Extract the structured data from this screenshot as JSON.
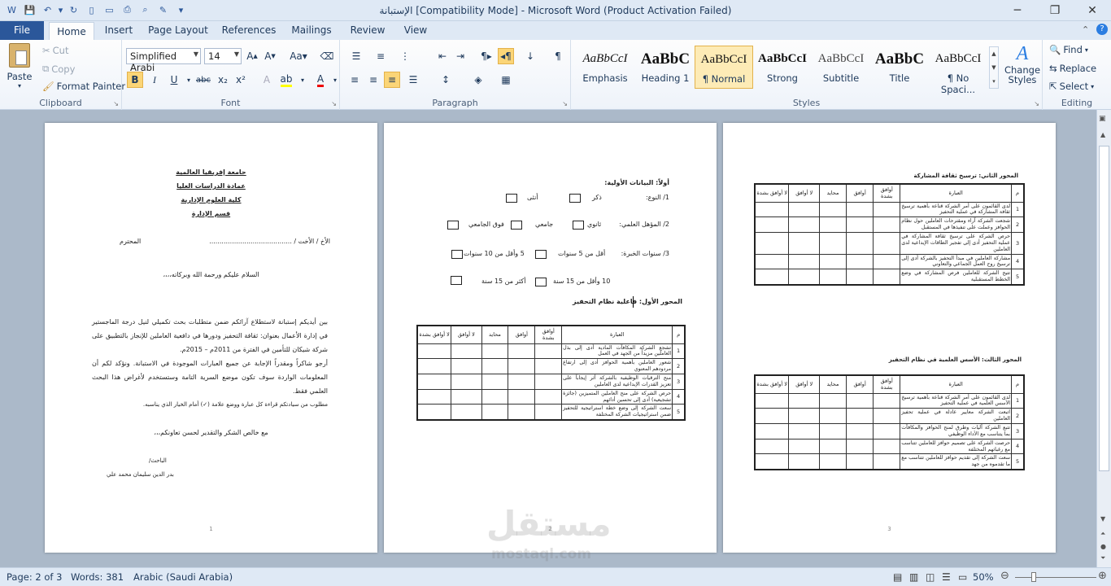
{
  "window": {
    "title": "الإستبانة [Compatibility Mode]  -  Microsoft Word (Product Activation Failed)"
  },
  "tabs": [
    {
      "label": "File"
    },
    {
      "label": "Home"
    },
    {
      "label": "Insert"
    },
    {
      "label": "Page Layout"
    },
    {
      "label": "References"
    },
    {
      "label": "Mailings"
    },
    {
      "label": "Review"
    },
    {
      "label": "View"
    }
  ],
  "clipboard": {
    "paste": "Paste",
    "cut": "Cut",
    "copy": "Copy",
    "format_painter": "Format Painter",
    "group": "Clipboard"
  },
  "font": {
    "name": "Simplified Arabi",
    "size": "14",
    "group": "Font"
  },
  "paragraph": {
    "group": "Paragraph"
  },
  "styles": {
    "group": "Styles",
    "items": [
      {
        "preview": "AaBbCcI",
        "name": "Emphasis"
      },
      {
        "preview": "AaBbC",
        "name": "Heading 1"
      },
      {
        "preview": "AaBbCcI",
        "name": "¶ Normal"
      },
      {
        "preview": "AaBbCcI",
        "name": "Strong"
      },
      {
        "preview": "AaBbCcI",
        "name": "Subtitle"
      },
      {
        "preview": "AaBbC",
        "name": "Title"
      },
      {
        "preview": "AaBbCcI",
        "name": "¶ No Spaci..."
      }
    ],
    "change": "Change Styles"
  },
  "editing": {
    "find": "Find",
    "replace": "Replace",
    "select": "Select",
    "group": "Editing"
  },
  "page1": {
    "h1": "جامعة إفريقيا العالمية",
    "h2": "عمادة الدراسات العليا",
    "h3": "كلية العلوم الإدارية",
    "h4": "قسم الإدارة",
    "address": "الأخ / الأخت / ........................................",
    "respect": "المحترم",
    "greeting": "السلام عليكم ورحمة الله وبركاته،،،،",
    "body1": "بين أيديكم إستبانة لاستطلاع آرائكم ضمن متطلبات بحث تكميلي لنيل درجة الماجستير في إدارة الأعمال بعنوان: ثقافة التحفيز ودورها في دافعية العاملين للإنجاز بالتطبيق على شركة شيكان للتأمين في الفترة من 2011م – 2015م.",
    "body2": "أرجو شاكراً ومقدراً الإجابة عن جميع العبارات الموجودة في الاستبانة. ونؤكد لكم أن المعلومات الواردة سوف تكون موضع السرية التامة وستستخدم لأغراض هذا البحث العلمي فقط.",
    "body3": "مطلوب من سيادتكم قراءة كل عبارة ووضع علامة (✓) أمام الخيار الذي يناسبه.",
    "thanks": "مع خالص الشكر والتقدير لحسن تعاونكم،،،",
    "researcher": "الباحث/",
    "researcher_name": "بدر الدين سليمان محمد علي",
    "pnum": "1"
  },
  "page2": {
    "section": "أولاً: البيانات الأولية:",
    "q1": "1/ النوع:",
    "male": "ذكر",
    "female": "أنثى",
    "q2": "2/ المؤهل العلمي:",
    "o1": "ثانوي",
    "o2": "جامعي",
    "o3": "فوق الجامعي",
    "q3": "3/ سنوات الخبرة:",
    "e1": "أقل من 5 سنوات",
    "e2": "5 وأقل من 10 سنوات",
    "e3": "10 وأقل من 15 سنة",
    "e4": "أكثر من 15 سنة",
    "axis": "المحور الأول: فاعلية نظام التحفيز",
    "pnum": "2"
  },
  "table_headers": [
    "م",
    "العبارة",
    "أوافق بشدة",
    "أوافق",
    "محايد",
    "لا أوافق",
    "لا أوافق بشدة"
  ],
  "table1_rows": [
    {
      "n": "1",
      "text": "تشجع الشركة المكافآت المادية أدى إلى بذل العاملين مزيداً من الجهد في العمل"
    },
    {
      "n": "2",
      "text": "شعور العاملين بأهمية الحوافز أدى إلى ارتفاع مردودهم المعنوي"
    },
    {
      "n": "3",
      "text": "منح الترقيات الوظيفية بالشركة أثر إيجاباً على تعزيز القدرات الإبداعية لدى العاملين"
    },
    {
      "n": "4",
      "text": "حرص الشركة على منح العاملين المتميزين (جائزة تشجيعية) أدى إلى تحسين أدائهم"
    },
    {
      "n": "5",
      "text": "سعت الشركة إلى وضع خطة استراتيجية للتحفيز ضمن استراتيجيات الشركة المختلفة"
    }
  ],
  "page3": {
    "axis2": "المحور الثاني: ترسيخ ثقافة المشاركة",
    "axis3": "المحور الثالث: الأسس العلمية في نظام التحفيز",
    "pnum": "3"
  },
  "table2_rows": [
    {
      "n": "1",
      "text": "لدى القائمون على أمر الشركة قناعة بأهمية ترسيخ ثقافة المشاركة في عملية التحفيز"
    },
    {
      "n": "2",
      "text": "شجعت الشركة آراء ومقترحات العاملين حول نظام الحوافز وعملت على تنفيذها في المستقبل"
    },
    {
      "n": "3",
      "text": "حرص الشركة على ترسيخ ثقافة المشاركة في عملية التحفيز أدى إلى تفجير الطاقات الإبداعية لدى العاملين"
    },
    {
      "n": "4",
      "text": "مشاركة العاملين في مبدأ التحفيز بالشركة أدى إلى ترسيخ روح العمل الجماعي والتعاوني"
    },
    {
      "n": "5",
      "text": "تتيح الشركة للعاملين فرص المشاركة في وضع الخطط المستقبلية"
    }
  ],
  "table3_rows": [
    {
      "n": "1",
      "text": "لدى القائمون على أمر الشركة قناعة بأهمية ترسيخ الأسس العلمية في عملية التحفيز"
    },
    {
      "n": "2",
      "text": "اتبعت الشركة معايير عادلة في عملية تحفيز العاملين"
    },
    {
      "n": "3",
      "text": "تتبع الشركة آليات وطرق لمنح الحوافز والمكافآت بما يتناسب مع الأداء الوظيفي"
    },
    {
      "n": "4",
      "text": "حرصت الشركة على تصميم حوافز للعاملين تتناسب مع رغباتهم المختلفة"
    },
    {
      "n": "5",
      "text": "سعت الشركة إلى تقديم حوافز للعاملين تتناسب مع ما تقدموه من جهد"
    }
  ],
  "status": {
    "page": "Page: 2 of 3",
    "words": "Words: 381",
    "lang": "Arabic (Saudi Arabia)",
    "zoom": "50%"
  },
  "watermark": {
    "ar": "مستقل",
    "en": "mostaql.com"
  }
}
